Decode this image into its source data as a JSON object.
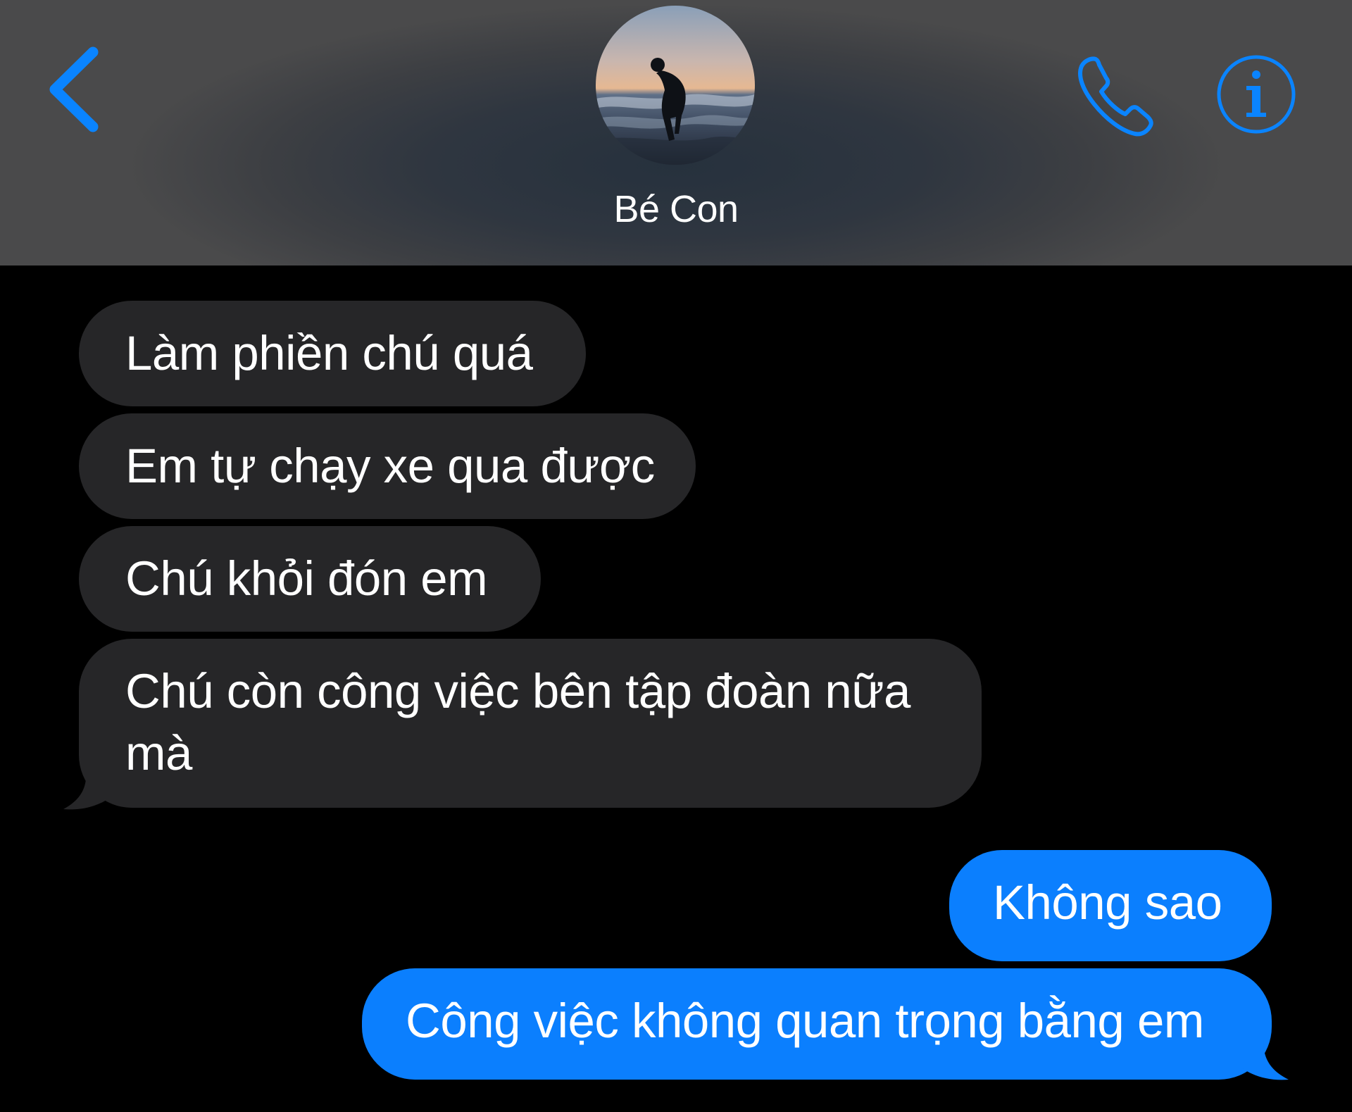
{
  "header": {
    "contact_name": "Bé Con",
    "avatar_description": "contact photo",
    "back_icon": "chevron-left-icon",
    "call_icon": "phone-icon",
    "info_icon": "info-icon",
    "accent_color": "#0a84ff",
    "background_color": "#3a3c40"
  },
  "messages": [
    {
      "direction": "incoming",
      "text": "Làm phiền chú quá"
    },
    {
      "direction": "incoming",
      "text": "Em tự chạy xe qua được"
    },
    {
      "direction": "incoming",
      "text": "Chú khỏi đón em"
    },
    {
      "direction": "incoming",
      "text": "Chú còn công việc bên tập đoàn nữa mà"
    },
    {
      "direction": "outgoing",
      "text": "Không sao"
    },
    {
      "direction": "outgoing",
      "text": "Công việc không quan trọng bằng em"
    }
  ],
  "colors": {
    "incoming_bubble": "#262628",
    "outgoing_bubble": "#0b7ffe",
    "thread_background": "#000000",
    "text": "#ffffff"
  }
}
